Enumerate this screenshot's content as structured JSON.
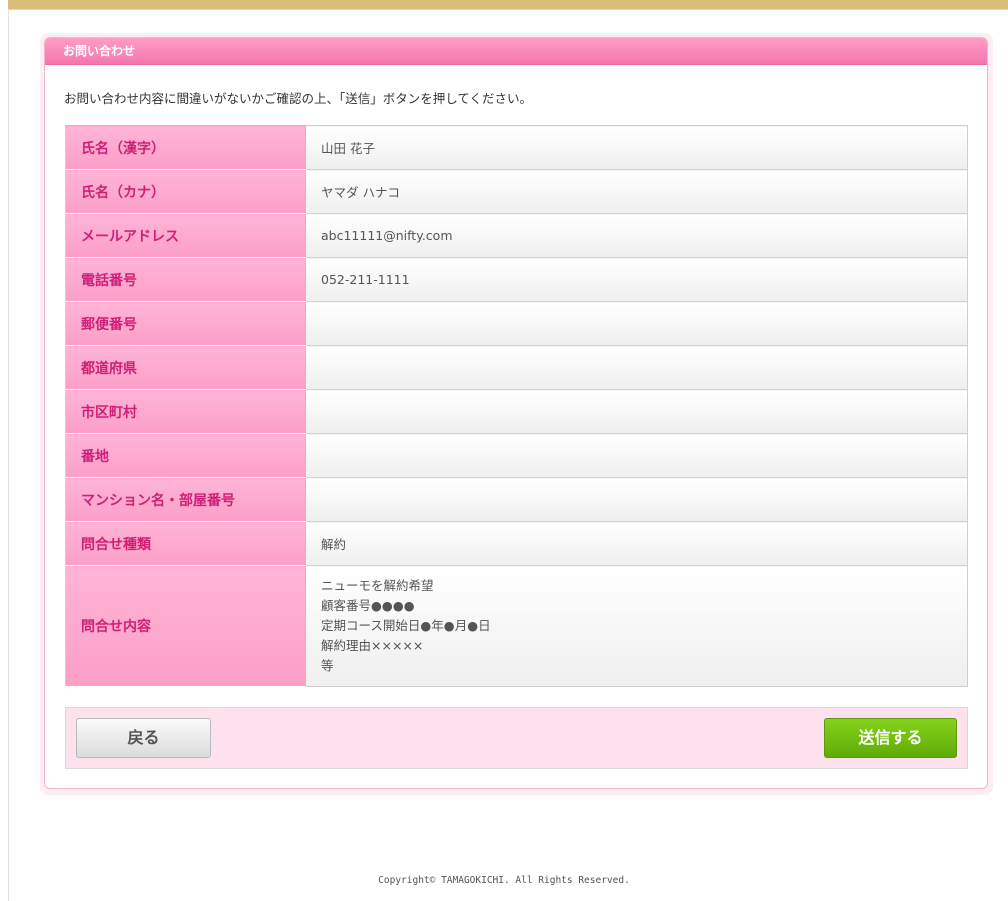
{
  "panel": {
    "title": "お問い合わせ",
    "intro": "お問い合わせ内容に間違いがないかご確認の上、「送信」ボタンを押してください。"
  },
  "rows": [
    {
      "label": "氏名（漢字）",
      "value": "山田 花子"
    },
    {
      "label": "氏名（カナ）",
      "value": "ヤマダ ハナコ"
    },
    {
      "label": "メールアドレス",
      "value": "abc11111@nifty.com"
    },
    {
      "label": "電話番号",
      "value": "052-211-1111"
    },
    {
      "label": "郵便番号",
      "value": ""
    },
    {
      "label": "都道府県",
      "value": ""
    },
    {
      "label": "市区町村",
      "value": ""
    },
    {
      "label": "番地",
      "value": ""
    },
    {
      "label": "マンション名・部屋番号",
      "value": ""
    },
    {
      "label": "問合せ種類",
      "value": "解約"
    },
    {
      "label": "問合せ内容",
      "lines": [
        "ニューモを解約希望",
        "顧客番号●●●●",
        "定期コース開始日●年●月●日",
        "解約理由×××××",
        "等"
      ]
    }
  ],
  "buttons": {
    "back": "戻る",
    "send": "送信する"
  },
  "footer": "Copyright© TAMAGOKICHI. All Rights Reserved.",
  "colors": {
    "pink_header": "#f577ad",
    "label_text": "#d01f77",
    "send_button": "#5fac07",
    "top_bar": "#d9bb7a"
  }
}
